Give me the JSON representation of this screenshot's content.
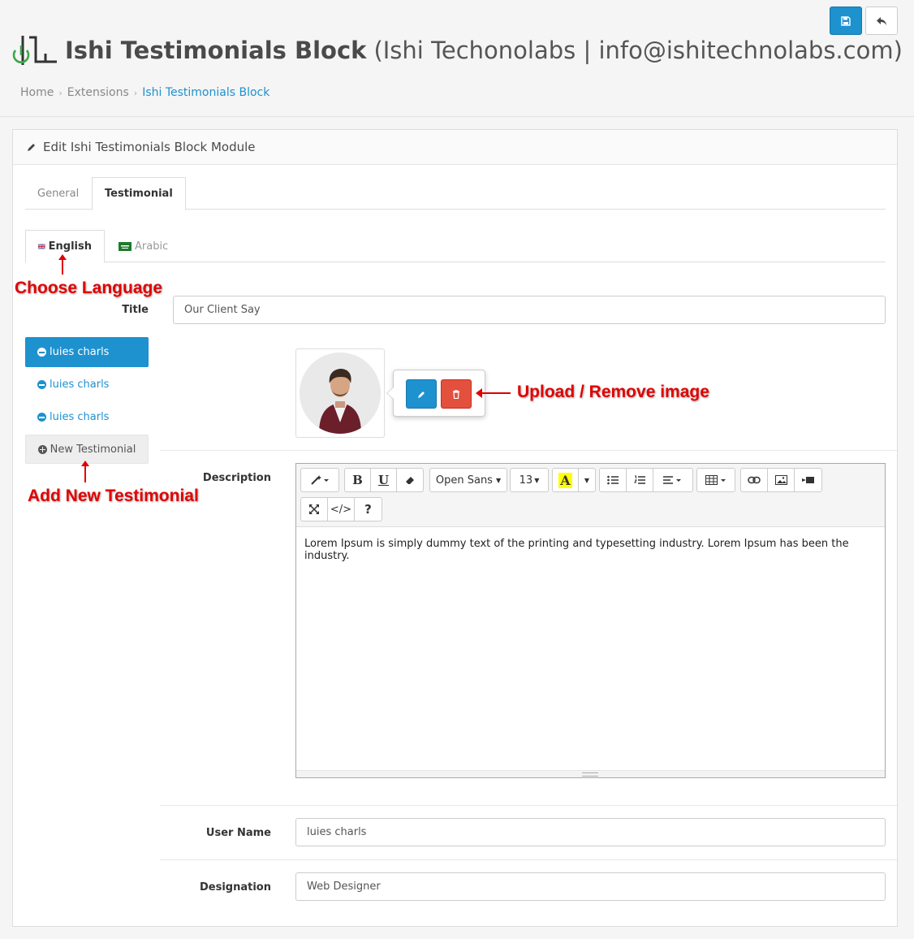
{
  "header": {
    "title": "Ishi Testimonials Block",
    "subtitle": "(Ishi Techonolabs | info@ishitechnolabs.com)"
  },
  "breadcrumb": [
    "Home",
    "Extensions",
    "Ishi Testimonials Block"
  ],
  "panel": {
    "heading": "Edit Ishi Testimonials Block Module"
  },
  "tabs": [
    {
      "label": "General",
      "active": false
    },
    {
      "label": "Testimonial",
      "active": true
    }
  ],
  "language_tabs": [
    {
      "label": "English",
      "active": true
    },
    {
      "label": "Arabic",
      "active": false
    }
  ],
  "form": {
    "title_label": "Title",
    "title_value": "Our Client Say",
    "description_label": "Description",
    "description_value": "Lorem Ipsum is simply dummy text of the printing and typesetting industry. Lorem Ipsum has been the industry.",
    "username_label": "User Name",
    "username_value": "luies charls",
    "designation_label": "Designation",
    "designation_value": "Web Designer"
  },
  "testimonial_list": [
    {
      "label": "luies charls",
      "active": true
    },
    {
      "label": "luies charls",
      "active": false
    },
    {
      "label": "luies charls",
      "active": false
    }
  ],
  "new_testimonial_label": "New Testimonial",
  "editor": {
    "font_family": "Open Sans",
    "font_size": "13",
    "highlight_letter": "A",
    "bold_letter": "B",
    "underline_letter": "U",
    "help_symbol": "?",
    "code_symbol": "</>"
  },
  "annotations": {
    "choose_language": "Choose Language",
    "upload_remove": "Upload / Remove image",
    "add_new": "Add New Testimonial"
  },
  "colors": {
    "primary": "#1e91cf",
    "danger": "#e3503e",
    "annotation": "#e10000"
  }
}
